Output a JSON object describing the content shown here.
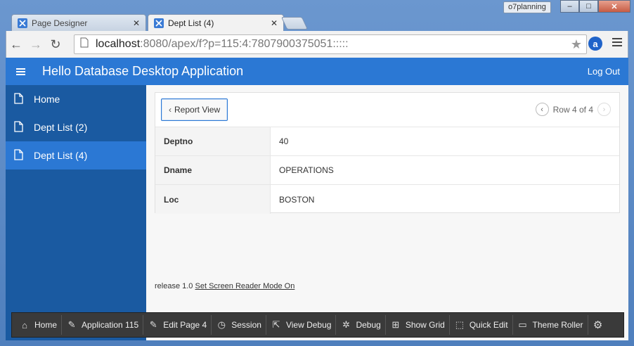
{
  "browser": {
    "tabs": [
      {
        "label": "Page Designer",
        "active": false
      },
      {
        "label": "Dept List (4)",
        "active": true
      }
    ],
    "profile_name": "o7planning",
    "url_host": "localhost",
    "url_path": ":8080/apex/f?p=115:4:7807900375051:::::",
    "window_buttons": [
      "–",
      "□",
      "✕"
    ],
    "ext_letter": "a"
  },
  "app": {
    "title": "Hello Database Desktop Application",
    "logout_label": "Log Out"
  },
  "sidebar": {
    "items": [
      {
        "label": "Home",
        "active": false
      },
      {
        "label": "Dept List (2)",
        "active": false
      },
      {
        "label": "Dept List (4)",
        "active": true
      }
    ]
  },
  "region": {
    "report_button_label": "Report View",
    "pager_text": "Row 4 of 4",
    "rows": [
      {
        "label": "Deptno",
        "value": "40"
      },
      {
        "label": "Dname",
        "value": "OPERATIONS"
      },
      {
        "label": "Loc",
        "value": "BOSTON"
      }
    ]
  },
  "footer": {
    "release_text": "release 1.0",
    "link_text": "Set Screen Reader Mode On"
  },
  "devbar": {
    "items": [
      {
        "label": "Home",
        "icon": "home-icon"
      },
      {
        "label": "Application 115",
        "icon": "edit-icon"
      },
      {
        "label": "Edit Page 4",
        "icon": "edit-icon"
      },
      {
        "label": "Session",
        "icon": "clock-icon"
      },
      {
        "label": "View Debug",
        "icon": "view-debug-icon"
      },
      {
        "label": "Debug",
        "icon": "bug-icon"
      },
      {
        "label": "Show Grid",
        "icon": "grid-icon"
      },
      {
        "label": "Quick Edit",
        "icon": "cursor-icon"
      },
      {
        "label": "Theme Roller",
        "icon": "paint-roller-icon"
      },
      {
        "label": "",
        "icon": "gear-icon"
      }
    ]
  },
  "colors": {
    "header_blue": "#2b78d4",
    "sidebar_blue": "#1a5aa1",
    "devbar_bg": "#3a3a3a"
  }
}
